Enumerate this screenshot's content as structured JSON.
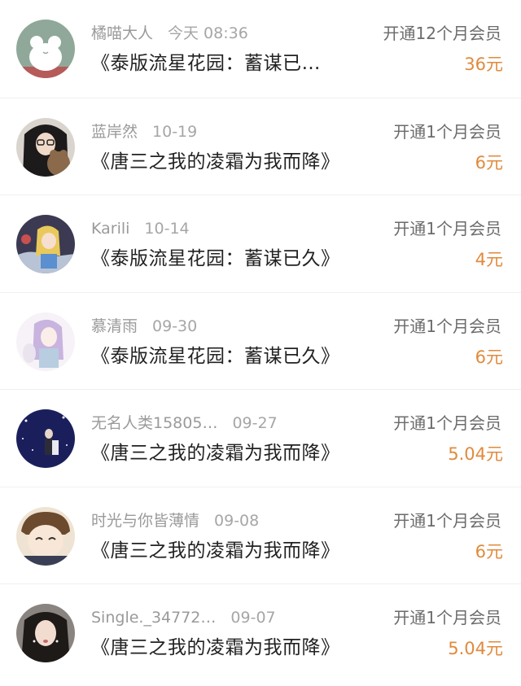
{
  "records": [
    {
      "name": "橘喵大人",
      "time": "今天 08:36",
      "action": "开通12个月会员",
      "book": "《泰版流星花园：蓄谋已…",
      "price": "36元",
      "avatar_icon": "white-frog-avatar-icon"
    },
    {
      "name": "蓝岸然",
      "time": "10-19",
      "action": "开通1个月会员",
      "book": "《唐三之我的凌霜为我而降》",
      "price": "6元",
      "avatar_icon": "girl-with-teddy-bear-avatar-icon"
    },
    {
      "name": "Karili",
      "time": "10-14",
      "action": "开通1个月会员",
      "book": "《泰版流星花园：蓄谋已久》",
      "price": "4元",
      "avatar_icon": "anime-blonde-girl-avatar-icon"
    },
    {
      "name": "慕清雨",
      "time": "09-30",
      "action": "开通1个月会员",
      "book": "《泰版流星花园：蓄谋已久》",
      "price": "6元",
      "avatar_icon": "anime-purple-hair-avatar-icon"
    },
    {
      "name": "无名人类15805…",
      "time": "09-27",
      "action": "开通1个月会员",
      "book": "《唐三之我的凌霜为我而降》",
      "price": "5.04元",
      "avatar_icon": "night-sky-couple-avatar-icon"
    },
    {
      "name": "时光与你皆薄情",
      "time": "09-08",
      "action": "开通1个月会员",
      "book": "《唐三之我的凌霜为我而降》",
      "price": "6元",
      "avatar_icon": "anime-boy-avatar-icon"
    },
    {
      "name": "Single._34772…",
      "time": "09-07",
      "action": "开通1个月会员",
      "book": "《唐三之我的凌霜为我而降》",
      "price": "5.04元",
      "avatar_icon": "dark-hair-girl-avatar-icon"
    }
  ],
  "colors": {
    "meta_text": "#9a9a9a",
    "title_text": "#222222",
    "action_text": "#6b6b6b",
    "price_text": "#e08a3c",
    "divider": "#f0f0f0"
  }
}
